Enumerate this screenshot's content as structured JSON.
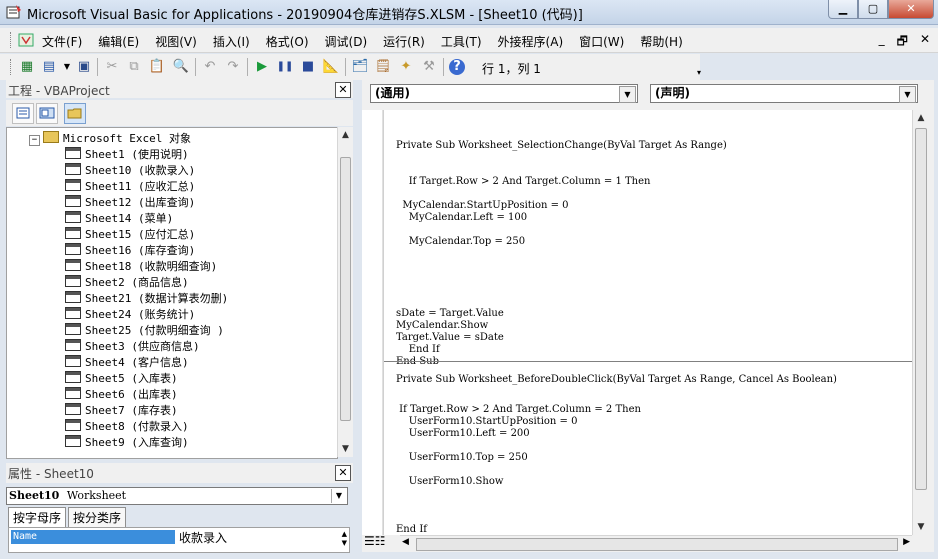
{
  "window": {
    "title": "Microsoft Visual Basic for Applications - 20190904仓库进销存S.XLSM - [Sheet10 (代码)]",
    "min_label": "▁",
    "max_label": "▢",
    "close_label": "✕"
  },
  "menu": {
    "items": [
      "文件(F)",
      "编辑(E)",
      "视图(V)",
      "插入(I)",
      "格式(O)",
      "调试(D)",
      "运行(R)",
      "工具(T)",
      "外接程序(A)",
      "窗口(W)",
      "帮助(H)"
    ],
    "mdi_buttons": [
      "_",
      "🗗",
      "✕"
    ]
  },
  "toolbar": {
    "cursor_position": "行 1，列 1"
  },
  "project": {
    "title": "工程 - VBAProject",
    "close": "✕",
    "folder": "Microsoft Excel 对象",
    "sheets": [
      "Sheet1 (使用说明)",
      "Sheet10 (收款录入)",
      "Sheet11 (应收汇总)",
      "Sheet12 (出库查询)",
      "Sheet14 (菜单)",
      "Sheet15 (应付汇总)",
      "Sheet16 (库存查询)",
      "Sheet18 (收款明细查询)",
      "Sheet2 (商品信息)",
      "Sheet21 (数据计算表勿删)",
      "Sheet24 (账务统计)",
      "Sheet25 (付款明细查询 )",
      "Sheet3 (供应商信息)",
      "Sheet4 (客户信息)",
      "Sheet5 (入库表)",
      "Sheet6 (出库表)",
      "Sheet7 (库存表)",
      "Sheet8 (付款录入)",
      "Sheet9 (入库查询)"
    ]
  },
  "properties": {
    "title": "属性 - Sheet10",
    "close": "✕",
    "object_name": "Sheet10",
    "object_type": "Worksheet",
    "tabs": [
      "按字母序",
      "按分类序"
    ],
    "prop_name": "Name",
    "prop_value": "收款录入"
  },
  "code": {
    "object_combo": "(通用)",
    "proc_combo": "(声明)",
    "lines1": [
      "Private Sub Worksheet_SelectionChange(ByVal Target As Range)",
      "    If Target.Row > 2 And Target.Column = 1 Then",
      "  MyCalendar.StartUpPosition = 0",
      "    MyCalendar.Left = 100",
      "    MyCalendar.Top = 250",
      "sDate = Target.Value",
      "MyCalendar.Show",
      "Target.Value = sDate",
      "    End If",
      "End Sub"
    ],
    "lines2": [
      "Private Sub Worksheet_BeforeDoubleClick(ByVal Target As Range, Cancel As Boolean)",
      " If Target.Row > 2 And Target.Column = 2 Then",
      "    UserForm10.StartUpPosition = 0",
      "    UserForm10.Left = 200",
      "    UserForm10.Top = 250",
      "    UserForm10.Show",
      "End If"
    ]
  }
}
